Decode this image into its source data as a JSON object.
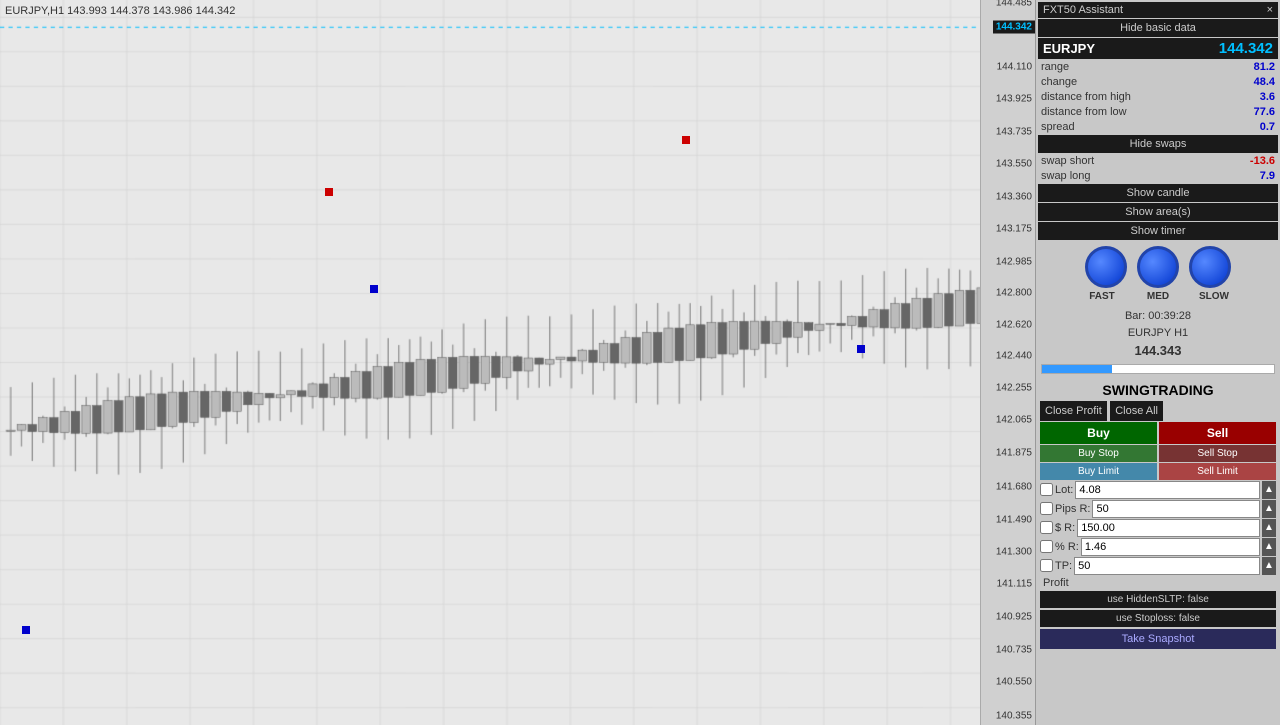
{
  "header": {
    "title": "FXT50 Assistant",
    "close_icon": "×"
  },
  "chart": {
    "title": "EURJPY,H1  143.993  144.378  143.986  144.342",
    "prices": [
      144.485,
      144.11,
      143.925,
      143.735,
      143.55,
      143.36,
      143.175,
      142.985,
      142.8,
      142.62,
      142.44,
      142.255,
      142.065,
      141.875,
      141.68,
      141.49,
      141.3,
      141.115,
      140.925,
      140.735,
      140.55,
      140.355
    ]
  },
  "basic_data": {
    "hide_button": "Hide basic data",
    "symbol": "EURJPY",
    "price": "144.342",
    "range_label": "range",
    "range_value": "81.2",
    "change_label": "change",
    "change_value": "48.4",
    "dist_high_label": "distance from high",
    "dist_high_value": "3.6",
    "dist_low_label": "distance from low",
    "dist_low_value": "77.6",
    "spread_label": "spread",
    "spread_value": "0.7"
  },
  "swaps": {
    "hide_button": "Hide swaps",
    "short_label": "swap short",
    "short_value": "-13.6",
    "long_label": "swap long",
    "long_value": "7.9"
  },
  "buttons": {
    "show_candle": "Show candle",
    "show_areas": "Show area(s)",
    "show_timer": "Show timer"
  },
  "speed": {
    "fast_label": "FAST",
    "med_label": "MED",
    "slow_label": "SLOW"
  },
  "bar_info": {
    "bar_label": "Bar:",
    "bar_time": "00:39:28",
    "symbol": "EURJPY H1",
    "price": "144.343"
  },
  "swing": {
    "title": "SWINGTRADING",
    "close_profit": "Close Profit",
    "close_all": "Close All",
    "buy": "Buy",
    "sell": "Sell",
    "buy_stop": "Buy Stop",
    "sell_stop": "Sell Stop",
    "buy_limit": "Buy Limit",
    "sell_limit": "Sell Limit",
    "lot_label": "Lot:",
    "lot_value": "4.08",
    "pips_label": "Pips R:",
    "pips_value": "50",
    "dollar_label": "$ R:",
    "dollar_value": "150.00",
    "percent_label": "% R:",
    "percent_value": "1.46",
    "tp_label": "TP:",
    "tp_value": "50",
    "hidden_sltp": "use HiddenSLTP: false",
    "stoploss": "use Stoploss: false",
    "snapshot": "Take Snapshot",
    "profit_label": "Profit"
  },
  "price_axis": {
    "labels": [
      "144.485",
      "144.110",
      "143.925",
      "143.735",
      "143.550",
      "143.360",
      "143.175",
      "142.985",
      "142.800",
      "142.620",
      "142.440",
      "142.255",
      "142.065",
      "141.875",
      "141.680",
      "141.490",
      "141.300",
      "141.115",
      "140.925",
      "140.735",
      "140.550",
      "140.355"
    ],
    "current": "144.342"
  }
}
